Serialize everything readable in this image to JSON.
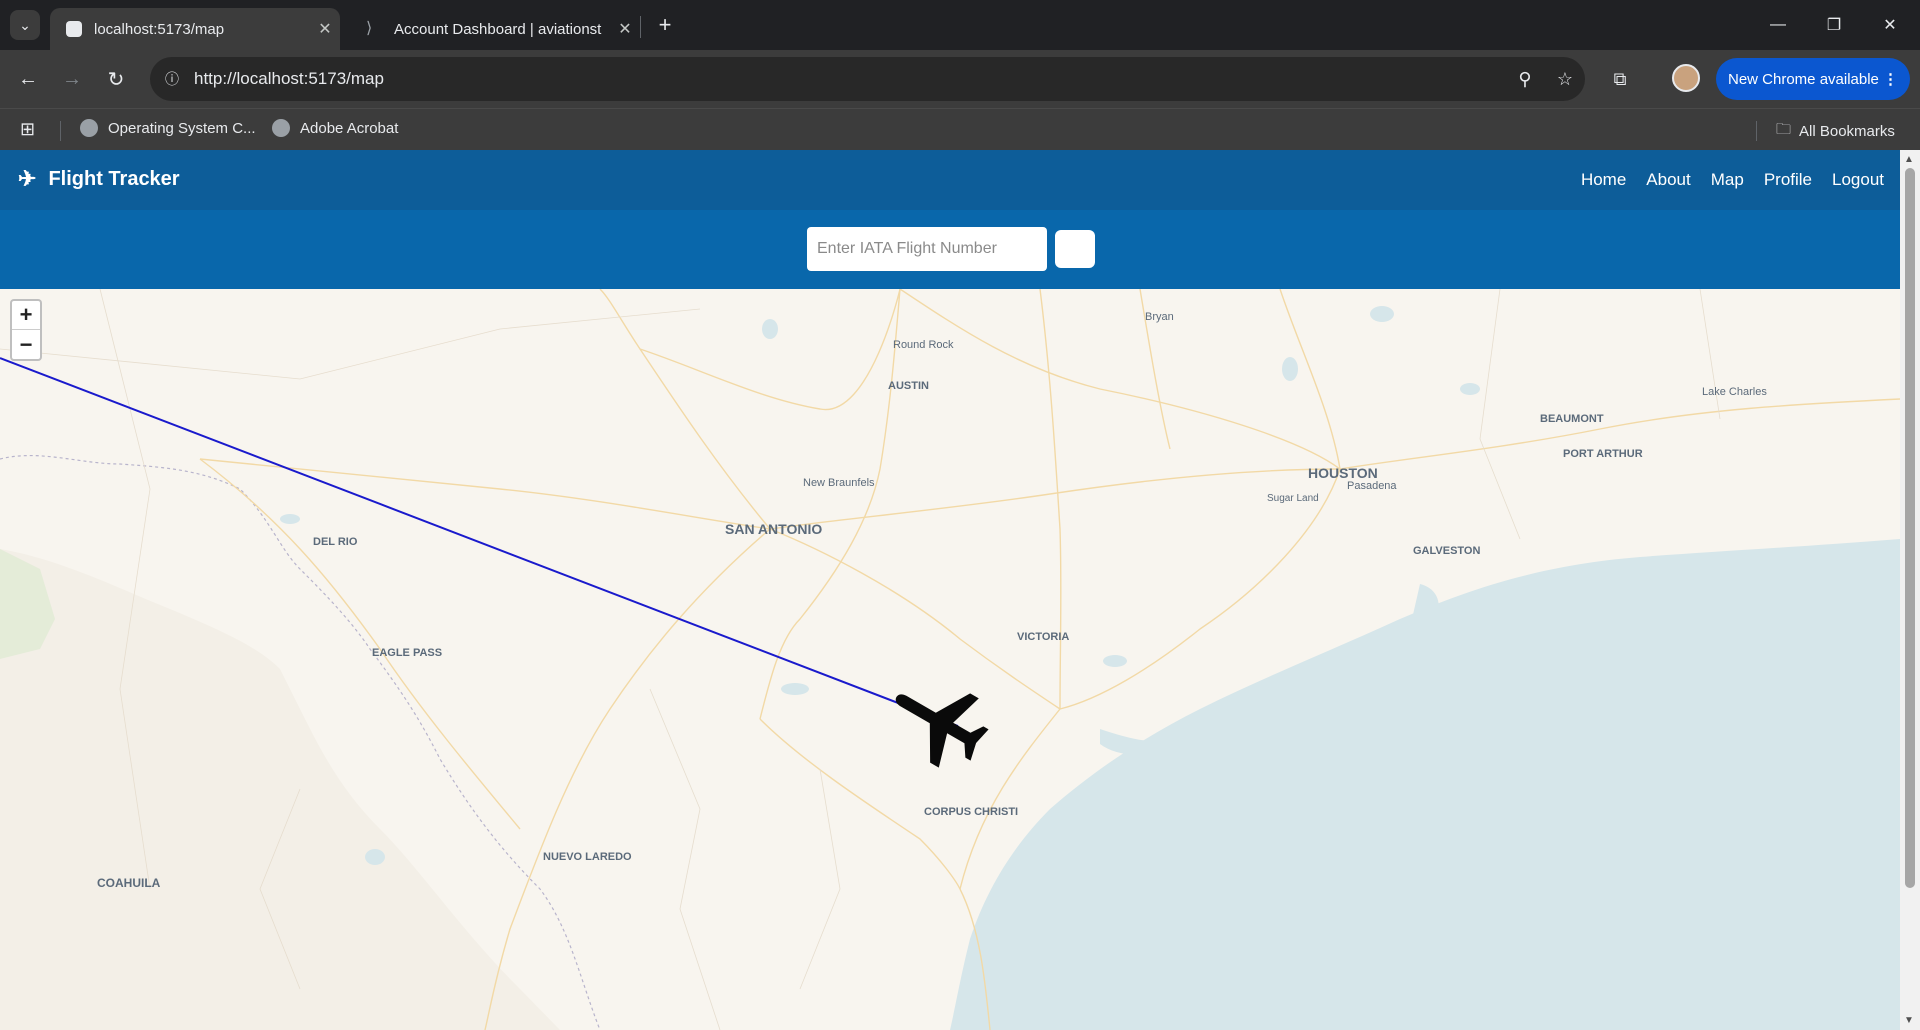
{
  "browser": {
    "tabs": [
      {
        "title": "localhost:5173/map",
        "active": true
      },
      {
        "title": "Account Dashboard | aviationst",
        "active": false
      }
    ],
    "url": "http://localhost:5173/map",
    "update_label": "New Chrome available",
    "bookmarks": [
      {
        "label": "Operating System C..."
      },
      {
        "label": "Adobe Acrobat"
      }
    ],
    "all_bookmarks_label": "All Bookmarks"
  },
  "app": {
    "brand": "Flight Tracker",
    "nav": [
      "Home",
      "About",
      "Map",
      "Profile",
      "Logout"
    ],
    "search": {
      "placeholder": "Enter IATA Flight Number",
      "value": ""
    },
    "zoom_in": "+",
    "zoom_out": "−"
  },
  "map": {
    "labels": [
      {
        "text": "Bryan"
      },
      {
        "text": "Round Rock"
      },
      {
        "text": "AUSTIN"
      },
      {
        "text": "Lake Charles"
      },
      {
        "text": "BEAUMONT"
      },
      {
        "text": "PORT ARTHUR"
      },
      {
        "text": "HOUSTON"
      },
      {
        "text": "Pasadena"
      },
      {
        "text": "Sugar Land"
      },
      {
        "text": "New Braunfels"
      },
      {
        "text": "SAN ANTONIO"
      },
      {
        "text": "GALVESTON"
      },
      {
        "text": "DEL RIO"
      },
      {
        "text": "VICTORIA"
      },
      {
        "text": "EAGLE PASS"
      },
      {
        "text": "CORPUS CHRISTI"
      },
      {
        "text": "NUEVO LAREDO"
      },
      {
        "text": "COAHUILA"
      }
    ],
    "colors": {
      "flight_path": "#1a1acc",
      "water": "#d6e6ea",
      "land": "#f8f5ef",
      "header": "#0d5d99",
      "search_bar": "#0967ab"
    }
  }
}
